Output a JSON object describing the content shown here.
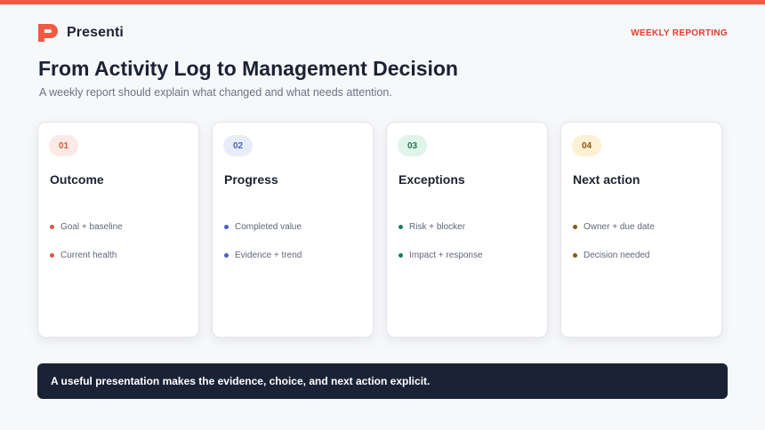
{
  "brand": {
    "name": "Presenti",
    "color": "#f05a44"
  },
  "kicker": "WEEKLY REPORTING",
  "title": "From Activity Log to Management Decision",
  "subtitle": "A weekly report should explain what changed and what needs attention.",
  "cards": [
    {
      "number": "01",
      "title": "Outcome",
      "accent": "#e0563f",
      "badge_bg": "#fdeae6",
      "bullets": [
        "Goal + baseline",
        "Current health"
      ]
    },
    {
      "number": "02",
      "title": "Progress",
      "accent": "#4a5fc7",
      "badge_bg": "#e9edfb",
      "bullets": [
        "Completed value",
        "Evidence + trend"
      ]
    },
    {
      "number": "03",
      "title": "Exceptions",
      "accent": "#1f7a56",
      "badge_bg": "#e1f4ea",
      "bullets": [
        "Risk + blocker",
        "Impact + response"
      ]
    },
    {
      "number": "04",
      "title": "Next action",
      "accent": "#8a5a0a",
      "badge_bg": "#fdf1d3",
      "bullets": [
        "Owner + due date",
        "Decision needed"
      ]
    }
  ],
  "banner": "A useful presentation makes the evidence, choice, and next action explicit."
}
